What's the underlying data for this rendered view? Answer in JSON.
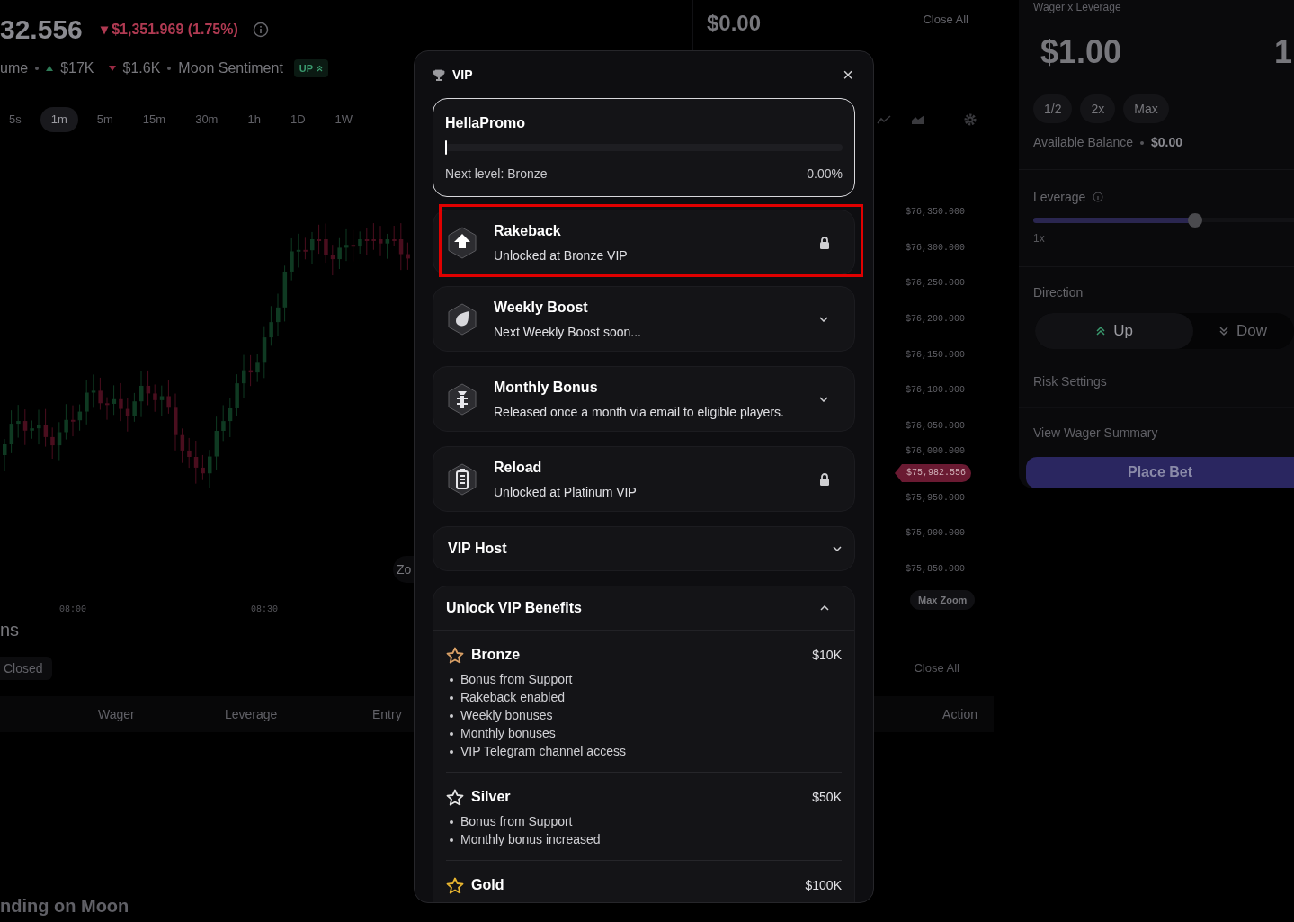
{
  "ticker": {
    "price": "32.556",
    "change": "$1,351.969 (1.75%)",
    "change_arrow": "▾",
    "volume_label": "ume",
    "volume_up": "$17K",
    "volume_down": "$1.6K",
    "sentiment_label": "Moon Sentiment",
    "sentiment": "UP"
  },
  "positions_value": {
    "value": "$0.00",
    "close_all": "Close All"
  },
  "timeframes": [
    {
      "label": "5s",
      "selected": false
    },
    {
      "label": "1m",
      "selected": true
    },
    {
      "label": "5m",
      "selected": false
    },
    {
      "label": "15m",
      "selected": false
    },
    {
      "label": "30m",
      "selected": false
    },
    {
      "label": "1h",
      "selected": false
    },
    {
      "label": "1D",
      "selected": false
    },
    {
      "label": "1W",
      "selected": false
    }
  ],
  "price_axis": [
    "$76,350.000",
    "$76,300.000",
    "$76,250.000",
    "$76,200.000",
    "$76,150.000",
    "$76,100.000",
    "$76,050.000",
    "$76,000.000",
    "$75,950.000",
    "$75,900.000",
    "$75,850.000"
  ],
  "current_price": "$75,982.556",
  "time_axis": [
    "08:00",
    "08:30"
  ],
  "zoom_button": "Zo",
  "max_zoom": "Max Zoom",
  "positions": {
    "title": "ns",
    "tab": "Closed",
    "close_all": "Close All",
    "columns": [
      "Wager",
      "Leverage",
      "Entry",
      "Action"
    ]
  },
  "footer_title": "nding on Moon",
  "bet_panel": {
    "label": "Wager x Leverage",
    "wager": "$1.00",
    "leverage_value": "1",
    "quick": [
      "1/2",
      "2x",
      "Max"
    ],
    "balance_label": "Available Balance",
    "balance": "$0.00",
    "leverage_label": "Leverage",
    "leverage": {
      "level": 0.62
    },
    "leverage_min": "1x",
    "direction_label": "Direction",
    "directions": [
      {
        "label": "Up",
        "selected": true
      },
      {
        "label": "Dow",
        "selected": false
      }
    ],
    "risk": "Risk Settings",
    "summary": "View Wager Summary",
    "place_bet": "Place Bet"
  },
  "vip_modal": {
    "title": "VIP",
    "close": "×",
    "progress": {
      "name": "HellaPromo",
      "level": 0,
      "next": "Next level: Bronze",
      "percent": "0.00%"
    },
    "benefits": [
      {
        "kind": "locked",
        "title": "Rakeback",
        "subtitle": "Unlocked at Bronze VIP",
        "highlighted": true
      },
      {
        "kind": "collapsible",
        "title": "Weekly Boost",
        "subtitle": "Next Weekly Boost soon...",
        "highlighted": false
      },
      {
        "kind": "collapsible",
        "title": "Monthly Bonus",
        "subtitle": "Released once a month via email to eligible players.",
        "highlighted": false
      },
      {
        "kind": "locked",
        "title": "Reload",
        "subtitle": "Unlocked at Platinum VIP",
        "highlighted": false
      }
    ],
    "host": {
      "title": "VIP Host",
      "expanded": false
    },
    "tiers_section": {
      "title": "Unlock VIP Benefits",
      "expanded": true,
      "tiers": [
        {
          "name": "Bronze",
          "amount": "$10K",
          "color": "#d9a066",
          "perks": [
            "Bonus from Support",
            "Rakeback enabled",
            "Weekly bonuses",
            "Monthly bonuses",
            "VIP Telegram channel access"
          ]
        },
        {
          "name": "Silver",
          "amount": "$50K",
          "color": "#e5e5e5",
          "perks": [
            "Bonus from Support",
            "Monthly bonus increased"
          ]
        },
        {
          "name": "Gold",
          "amount": "$100K",
          "color": "#e8b530"
        }
      ]
    }
  }
}
